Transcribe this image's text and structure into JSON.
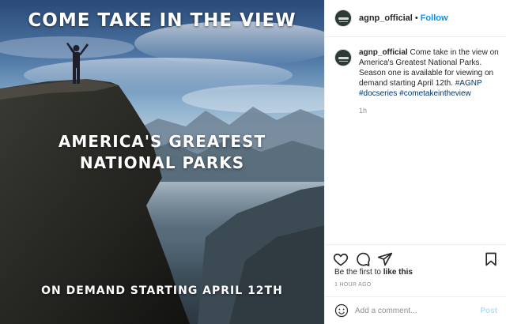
{
  "media": {
    "headline": "COME TAKE IN THE VIEW",
    "title_line1": "AMERICA'S GREATEST",
    "title_line2": "NATIONAL PARKS",
    "footer": "ON DEMAND STARTING APRIL 12TH"
  },
  "header": {
    "username": "agnp_official",
    "separator": "•",
    "follow_label": "Follow"
  },
  "caption": {
    "username": "agnp_official",
    "text": " Come take in the view on America's Greatest National Parks. Season one is available for viewing on demand starting April 12th. ",
    "hashtag1": "#AGNP",
    "hashtag2": "#docseries",
    "hashtag3": "#cometakeintheview",
    "time": "1h"
  },
  "actions": {
    "like_icon": "heart-icon",
    "comment_icon": "comment-icon",
    "share_icon": "share-icon",
    "save_icon": "bookmark-icon"
  },
  "likes": {
    "prefix": "Be the first to ",
    "link": "like this"
  },
  "timestamp": "1 HOUR AGO",
  "comment": {
    "placeholder": "Add a comment...",
    "post_label": "Post"
  },
  "colors": {
    "accent": "#0095f6",
    "hashtag": "#00376b",
    "muted": "#8e8e8e",
    "post_disabled": "#b2dffc"
  }
}
